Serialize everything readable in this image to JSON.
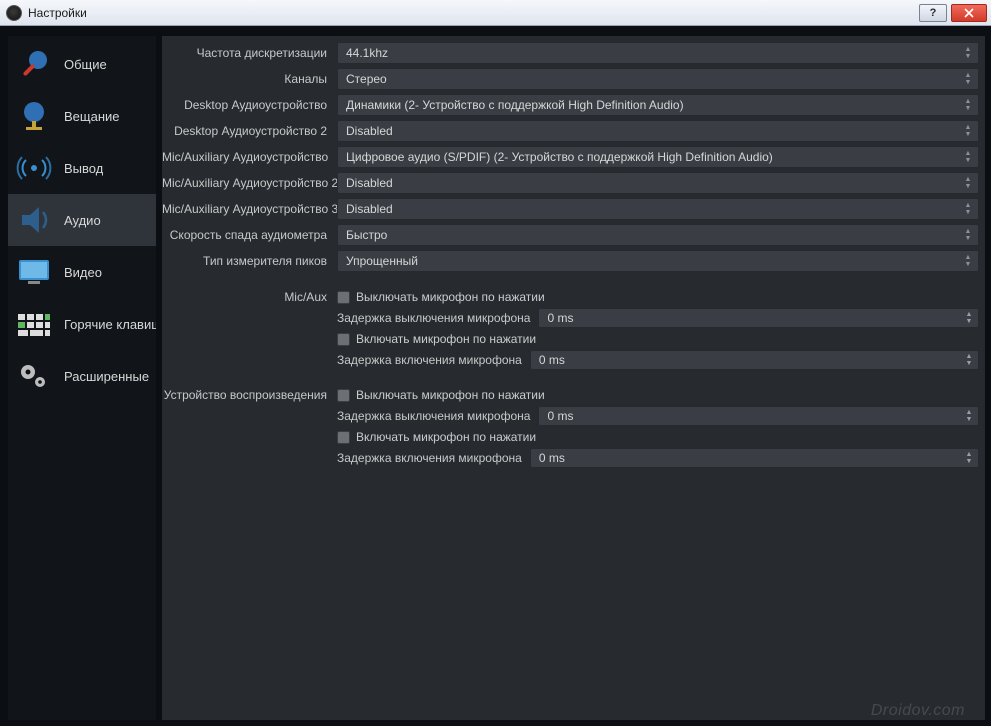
{
  "titlebar": {
    "title": "Настройки"
  },
  "sidebar": {
    "items": [
      {
        "id": "general",
        "label": "Общие"
      },
      {
        "id": "stream",
        "label": "Вещание"
      },
      {
        "id": "output",
        "label": "Вывод"
      },
      {
        "id": "audio",
        "label": "Аудио"
      },
      {
        "id": "video",
        "label": "Видео"
      },
      {
        "id": "hotkeys",
        "label": "Горячие клавиши"
      },
      {
        "id": "advanced",
        "label": "Расширенные"
      }
    ],
    "active": "audio"
  },
  "audio": {
    "sample_rate_label": "Частота дискретизации",
    "sample_rate_value": "44.1khz",
    "channels_label": "Каналы",
    "channels_value": "Стерео",
    "desktop1_label": "Desktop Аудиоустройство",
    "desktop1_value": "Динамики (2- Устройство с поддержкой High Definition Audio)",
    "desktop2_label": "Desktop Аудиоустройство 2",
    "desktop2_value": "Disabled",
    "mic1_label": "Mic/Auxiliary Аудиоустройство",
    "mic1_value": "Цифровое аудио (S/PDIF) (2- Устройство с поддержкой High Definition Audio)",
    "mic2_label": "Mic/Auxiliary Аудиоустройство 2",
    "mic2_value": "Disabled",
    "mic3_label": "Mic/Auxiliary Аудиоустройство 3",
    "mic3_value": "Disabled",
    "meter_decay_label": "Cкорость спада аудиометра",
    "meter_decay_value": "Быстро",
    "peak_meter_label": "Тип измерителя пиков",
    "peak_meter_value": "Упрощенный"
  },
  "ptt": {
    "micaux_label": "Mic/Aux",
    "playback_label": "Устройство воспроизведения",
    "ptm_label": "Выключать микрофон по нажатии",
    "ptm_delay_label": "Задержка выключения микрофона",
    "ptt_label": "Включать микрофон по нажатии",
    "ptt_delay_label": "Задержка включения микрофона",
    "delay_value": "0 ms"
  },
  "watermark": "Droidov.com"
}
